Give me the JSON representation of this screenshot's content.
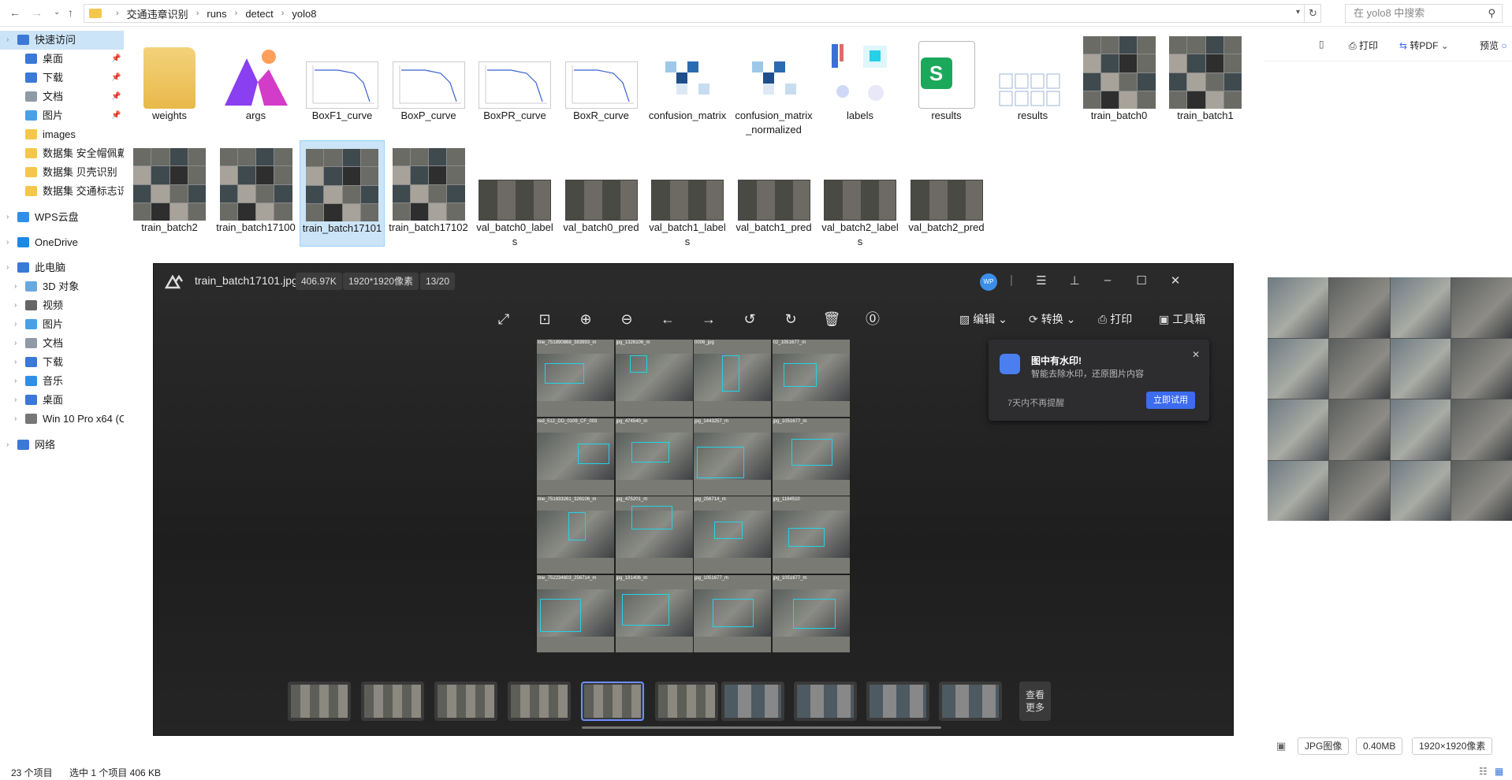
{
  "address": {
    "path": [
      "交通违章识别",
      "runs",
      "detect",
      "yolo8"
    ],
    "search_placeholder": "在 yolo8 中搜索"
  },
  "sidebar": {
    "items": [
      {
        "label": "快速访问",
        "icon": "star-icon"
      },
      {
        "label": "桌面",
        "icon": "desktop-icon"
      },
      {
        "label": "下载",
        "icon": "download-icon"
      },
      {
        "label": "文档",
        "icon": "document-icon"
      },
      {
        "label": "图片",
        "icon": "picture-icon"
      },
      {
        "label": "images",
        "icon": "folder-icon"
      },
      {
        "label": "数据集 安全帽佩戴",
        "icon": "folder-icon"
      },
      {
        "label": "数据集 贝壳识别",
        "icon": "folder-icon"
      },
      {
        "label": "数据集 交通标志识别",
        "icon": "folder-icon"
      },
      {
        "label": "WPS云盘",
        "icon": "cloud-icon"
      },
      {
        "label": "OneDrive",
        "icon": "cloud-icon"
      },
      {
        "label": "此电脑",
        "icon": "computer-icon"
      },
      {
        "label": "3D 对象",
        "icon": "cube-icon"
      },
      {
        "label": "视频",
        "icon": "video-icon"
      },
      {
        "label": "图片",
        "icon": "picture-icon"
      },
      {
        "label": "文档",
        "icon": "document-icon"
      },
      {
        "label": "下载",
        "icon": "download-icon"
      },
      {
        "label": "音乐",
        "icon": "music-icon"
      },
      {
        "label": "桌面",
        "icon": "desktop-icon"
      },
      {
        "label": "Win 10 Pro x64 (C:)",
        "icon": "drive-icon"
      },
      {
        "label": "网络",
        "icon": "network-icon"
      }
    ]
  },
  "files": {
    "row1": [
      "weights",
      "args",
      "BoxF1_curve",
      "BoxP_curve",
      "BoxPR_curve",
      "BoxR_curve",
      "confusion_matrix",
      "confusion_matrix_normalized",
      "labels",
      "results",
      "results",
      "train_batch0",
      "train_batch1"
    ],
    "row2": [
      "train_batch2",
      "train_batch17100",
      "train_batch17101",
      "train_batch17102",
      "val_batch0_labels",
      "val_batch0_pred",
      "val_batch1_labels",
      "val_batch1_pred",
      "val_batch2_labels",
      "val_batch2_pred"
    ]
  },
  "viewer": {
    "filename": "train_batch17101.jpg",
    "size": "406.97K",
    "dimensions": "1920*1920像素",
    "index": "13/20",
    "avatar": "WP",
    "tools": {
      "edit": "编辑",
      "convert": "转换",
      "print": "打印",
      "toolbox": "工具箱"
    },
    "notification": {
      "title": "图中有水印!",
      "subtitle": "智能去除水印，还原图片内容",
      "dismiss": "7天内不再提醒",
      "try": "立即试用"
    },
    "more": "查看\n更多",
    "captions": [
      "line_751890868_383993_m",
      "jpg_1326106_m",
      "0006_jpg",
      "02_1051677_m",
      "red_512_DD_0109_CF_003",
      "jpg_474540_m",
      "jpg_1443257_m",
      "jpg_1051677_m",
      "line_751833261_326106_m",
      "jpg_475201_m",
      "jpg_256714_m",
      "jpg_1164510",
      "line_752234603_256714_m",
      "jpg_191406_m",
      "jpg_1051677_m",
      "jpg_1051677_m"
    ]
  },
  "preview": {
    "print": "打印",
    "to_pdf": "转PDF",
    "preview": "预览",
    "type": "JPG图像",
    "filesize": "0.40MB",
    "dims": "1920×1920像素"
  },
  "status": {
    "count": "23 个项目",
    "selection": "选中 1 个项目  406 KB"
  },
  "colors": {
    "accent": "#3d6cf0",
    "selection": "#cce4f7",
    "viewer_bg": "#252525"
  }
}
